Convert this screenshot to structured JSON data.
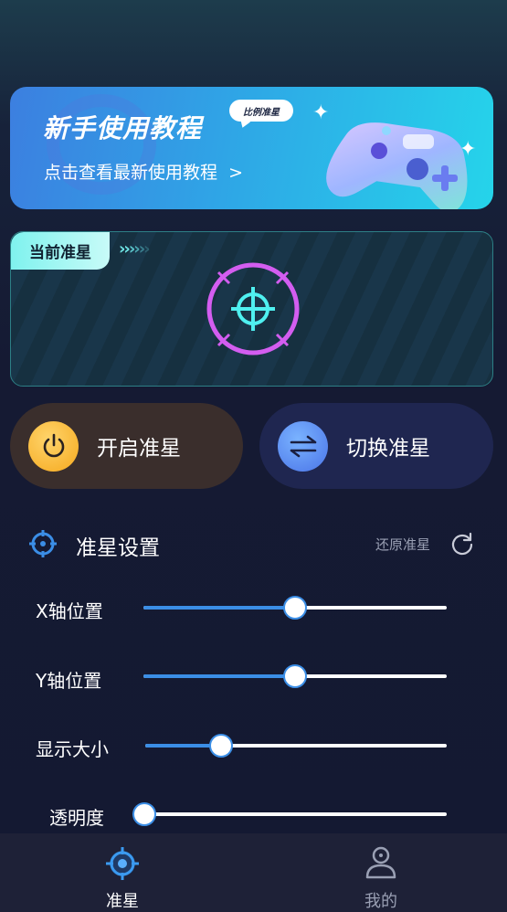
{
  "banner": {
    "title": "新手使用教程",
    "subtitle": "点击查看最新使用教程",
    "arrow": ">",
    "bubble": "比例准星"
  },
  "current_card": {
    "tag": "当前准星",
    "chevrons": ">>>>>>"
  },
  "actions": {
    "enable_label": "开启准星",
    "switch_label": "切换准星"
  },
  "settings": {
    "title": "准星设置",
    "reset_label": "还原准星",
    "sliders": [
      {
        "label": "X轴位置",
        "value": 0.5
      },
      {
        "label": "Y轴位置",
        "value": 0.5
      },
      {
        "label": "显示大小",
        "value": 0.25
      },
      {
        "label": "透明度",
        "value": 0.0
      }
    ]
  },
  "tabbar": {
    "tabs": [
      {
        "label": "准星",
        "active": true
      },
      {
        "label": "我的",
        "active": false
      }
    ]
  },
  "colors": {
    "accent": "#3b8ee6",
    "crosshair_cyan": "#4ff0f0",
    "crosshair_pink": "#d35df0",
    "power_yellow": "#f5b92a",
    "switch_blue": "#5a8df5"
  }
}
